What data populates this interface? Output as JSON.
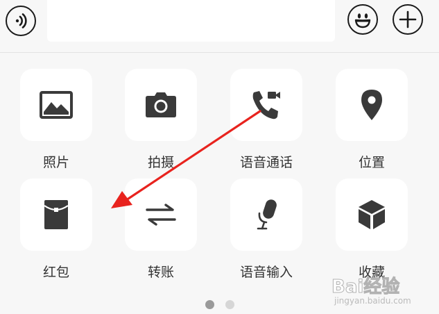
{
  "input_bar": {
    "voice_icon": "voice-toggle-icon",
    "emoji_icon": "smiley-icon",
    "plus_icon": "plus-icon",
    "text_value": ""
  },
  "panel": {
    "items": [
      {
        "label": "照片",
        "icon": "photo-icon"
      },
      {
        "label": "拍摄",
        "icon": "camera-icon"
      },
      {
        "label": "语音通话",
        "icon": "call-icon"
      },
      {
        "label": "位置",
        "icon": "location-icon"
      },
      {
        "label": "红包",
        "icon": "red-packet-icon"
      },
      {
        "label": "转账",
        "icon": "transfer-icon"
      },
      {
        "label": "语音输入",
        "icon": "microphone-icon"
      },
      {
        "label": "收藏",
        "icon": "favorites-icon"
      }
    ],
    "page_indicator": {
      "current": 1,
      "total": 2
    }
  },
  "annotation": {
    "color": "#e8231e"
  },
  "watermark": {
    "main": "Bai经验",
    "sub": "jingyan.baidu.com"
  },
  "colors": {
    "icon": "#3a3a3a",
    "tile": "#ffffff",
    "background": "#f7f7f7"
  }
}
